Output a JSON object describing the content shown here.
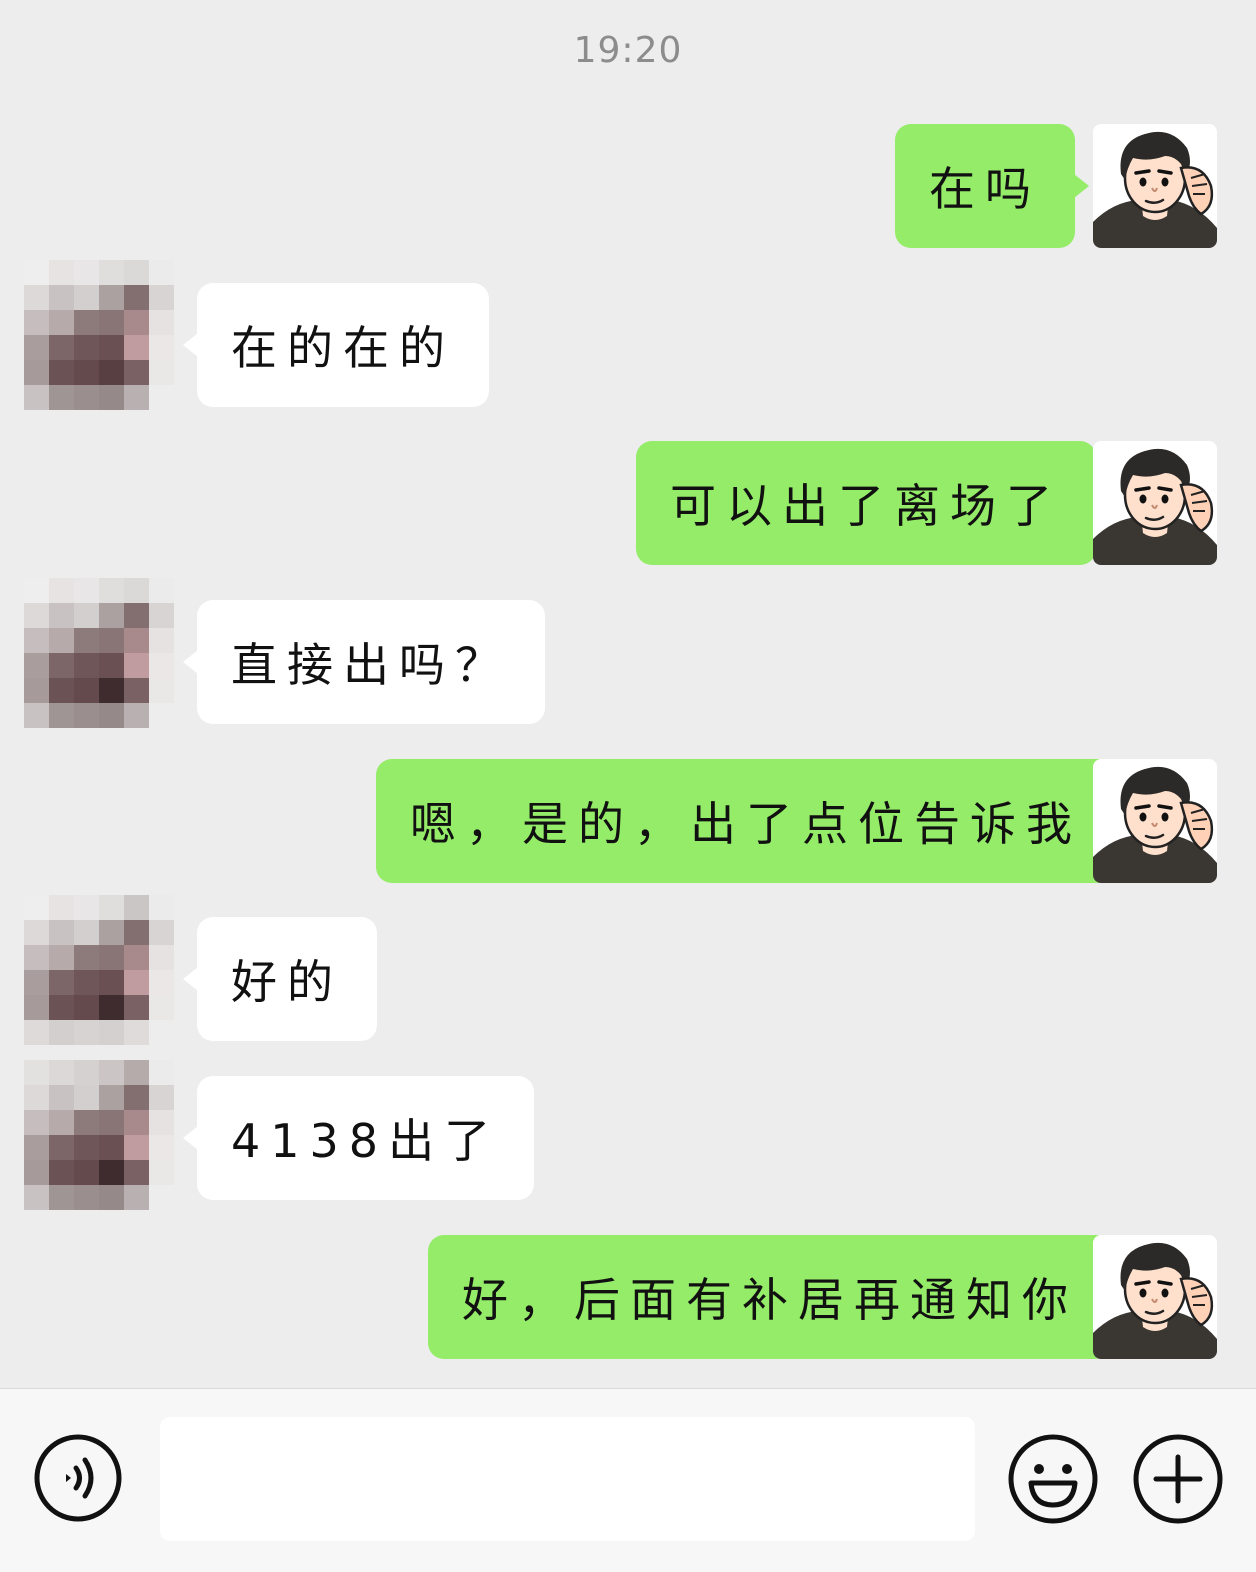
{
  "chat": {
    "timestamp": "19:20",
    "messages": [
      {
        "from": "me",
        "text": "在吗"
      },
      {
        "from": "them",
        "text": "在的在的"
      },
      {
        "from": "me",
        "text": "可以出了离场了"
      },
      {
        "from": "them",
        "text": "直接出吗？"
      },
      {
        "from": "me",
        "text": "嗯，是的，出了点位告诉我"
      },
      {
        "from": "them",
        "text": "好的"
      },
      {
        "from": "them",
        "text": "4138出了"
      },
      {
        "from": "me",
        "text": "好，后面有补居再通知你"
      }
    ]
  },
  "input_bar": {
    "message_input_value": "",
    "icons": {
      "voice": "voice-icon",
      "emoji": "emoji-icon",
      "more": "plus-icon"
    }
  },
  "colors": {
    "background": "#ededed",
    "my_bubble": "#95ec69",
    "their_bubble": "#ffffff",
    "input_bar": "#f7f7f7"
  }
}
